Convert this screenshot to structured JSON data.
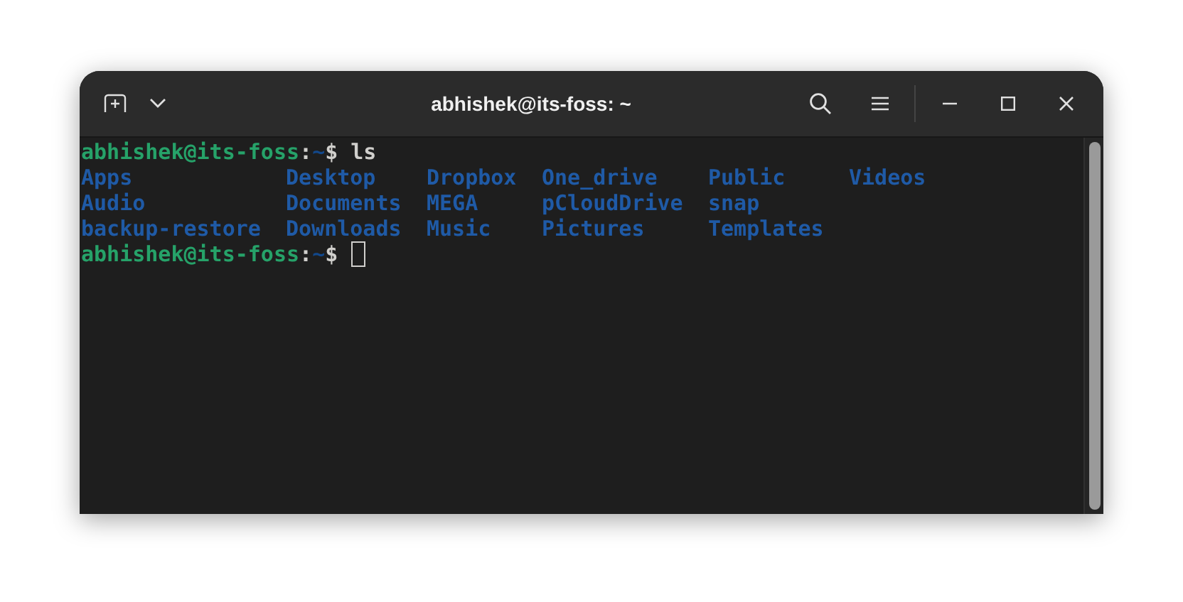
{
  "window": {
    "title": "abhishek@its-foss: ~"
  },
  "terminal": {
    "lines": [
      {
        "kind": "prompt",
        "user_host": "abhishek@its-foss",
        "separator": ":",
        "path": "~",
        "symbol": "$",
        "command": "ls"
      },
      {
        "kind": "listing",
        "columns": [
          [
            "Apps",
            "Audio",
            "backup-restore"
          ],
          [
            "Desktop",
            "Documents",
            "Downloads"
          ],
          [
            "Dropbox",
            "MEGA",
            "Music"
          ],
          [
            "One_drive",
            "pCloudDrive",
            "Pictures"
          ],
          [
            "Public",
            "snap",
            "Templates"
          ],
          [
            "Videos"
          ]
        ]
      },
      {
        "kind": "prompt",
        "user_host": "abhishek@its-foss",
        "separator": ":",
        "path": "~",
        "symbol": "$",
        "cursor": true
      }
    ]
  }
}
